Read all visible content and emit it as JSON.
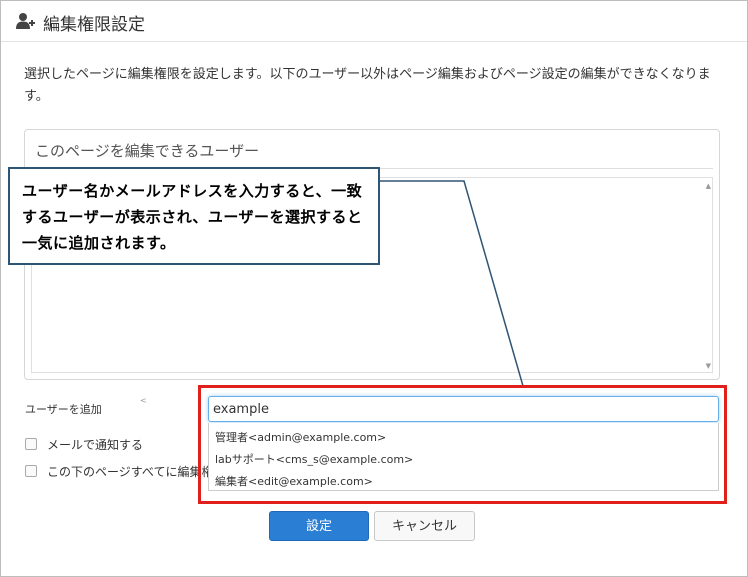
{
  "dialog": {
    "title": "編集権限設定",
    "title_icon": "user-add-icon",
    "description": "選択したページに編集権限を設定します。以下のユーザー以外はページ編集およびページ設定の編集ができなくなります。"
  },
  "panel": {
    "title": "このページを編集できるユーザー"
  },
  "callout": {
    "text": "ユーザー名かメールアドレスを入力すると、一致するユーザーが表示され、ユーザーを選択すると一気に追加されます。"
  },
  "form": {
    "add_user_label": "ユーザーを追加",
    "search_value": "example",
    "notify_email_label": "メールで通知する",
    "apply_children_label": "この下のページすべてに編集権"
  },
  "suggestions": [
    {
      "label": "管理者<admin@example.com>"
    },
    {
      "label": "labサポート<cms_s@example.com>"
    },
    {
      "label": "編集者<edit@example.com>"
    }
  ],
  "buttons": {
    "ok": "設定",
    "cancel": "キャンセル"
  },
  "colors": {
    "primary": "#2a7fd4",
    "highlight_border": "#e1201c",
    "callout_border": "#2f5575"
  }
}
